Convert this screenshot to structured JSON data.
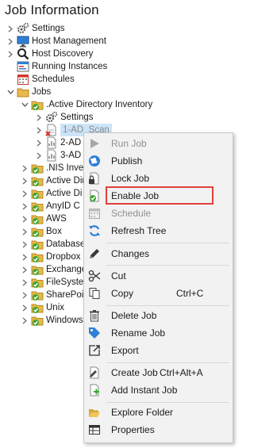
{
  "title": "Job Information",
  "tree": {
    "items": [
      {
        "label": "Settings",
        "icon": "gears-icon"
      },
      {
        "label": "Host Management",
        "icon": "monitor-icon"
      },
      {
        "label": "Host Discovery",
        "icon": "magnifier-icon"
      },
      {
        "label": "Running Instances",
        "icon": "running-instances-icon"
      },
      {
        "label": "Schedules",
        "icon": "calendar-icon"
      },
      {
        "label": "Jobs",
        "icon": "folder-icon"
      },
      {
        "label": ".Active Directory Inventory",
        "icon": "checked-folder-icon"
      },
      {
        "label": "Settings",
        "icon": "gears-icon"
      },
      {
        "label": "1-AD_Scan",
        "icon": "disabled-job-icon"
      },
      {
        "label": "2-AD",
        "icon": "job-icon"
      },
      {
        "label": "3-AD",
        "icon": "job-icon"
      },
      {
        "label": ".NIS Inve",
        "icon": "checked-folder-icon"
      },
      {
        "label": "Active Dire",
        "icon": "checked-folder-icon"
      },
      {
        "label": "Active Di",
        "icon": "checked-folder-icon"
      },
      {
        "label": "AnyID C",
        "icon": "checked-folder-icon"
      },
      {
        "label": "AWS",
        "icon": "checked-folder-icon"
      },
      {
        "label": "Box",
        "icon": "checked-folder-icon"
      },
      {
        "label": "Database",
        "icon": "checked-folder-icon"
      },
      {
        "label": "Dropbox",
        "icon": "checked-folder-icon"
      },
      {
        "label": "Exchange",
        "icon": "checked-folder-icon"
      },
      {
        "label": "FileSyste",
        "icon": "checked-folder-icon"
      },
      {
        "label": "SharePoin",
        "icon": "checked-folder-icon"
      },
      {
        "label": "Unix",
        "icon": "checked-folder-icon"
      },
      {
        "label": "Windows",
        "icon": "checked-folder-icon"
      }
    ]
  },
  "menu": {
    "items": [
      {
        "label": "Run Job",
        "icon": "play-icon",
        "disabled": true
      },
      {
        "label": "Publish",
        "icon": "publish-globe-icon"
      },
      {
        "label": "Lock Job",
        "icon": "lock-icon"
      },
      {
        "label": "Enable Job",
        "icon": "enable-job-icon"
      },
      {
        "label": "Schedule",
        "icon": "schedule-icon",
        "disabled": true
      },
      {
        "label": "Refresh Tree",
        "icon": "refresh-icon"
      },
      {
        "label": "Changes",
        "icon": "pencil-icon"
      },
      {
        "label": "Cut",
        "icon": "scissors-icon"
      },
      {
        "label": "Copy",
        "icon": "copy-icon",
        "shortcut": "Ctrl+C"
      },
      {
        "label": "Delete Job",
        "icon": "trash-icon"
      },
      {
        "label": "Rename Job",
        "icon": "tag-icon"
      },
      {
        "label": "Export",
        "icon": "export-icon"
      },
      {
        "label": "Create Job",
        "icon": "create-job-icon",
        "shortcut": "Ctrl+Alt+A"
      },
      {
        "label": "Add Instant Job",
        "icon": "add-instant-job-icon"
      },
      {
        "label": "Explore Folder",
        "icon": "open-folder-icon"
      },
      {
        "label": "Properties",
        "icon": "properties-grid-icon"
      }
    ]
  },
  "colors": {
    "highlight_border": "#e0403c",
    "selection": "#cce4f7",
    "check_green": "#3aa832",
    "folder_yellow": "#e8b84a"
  }
}
